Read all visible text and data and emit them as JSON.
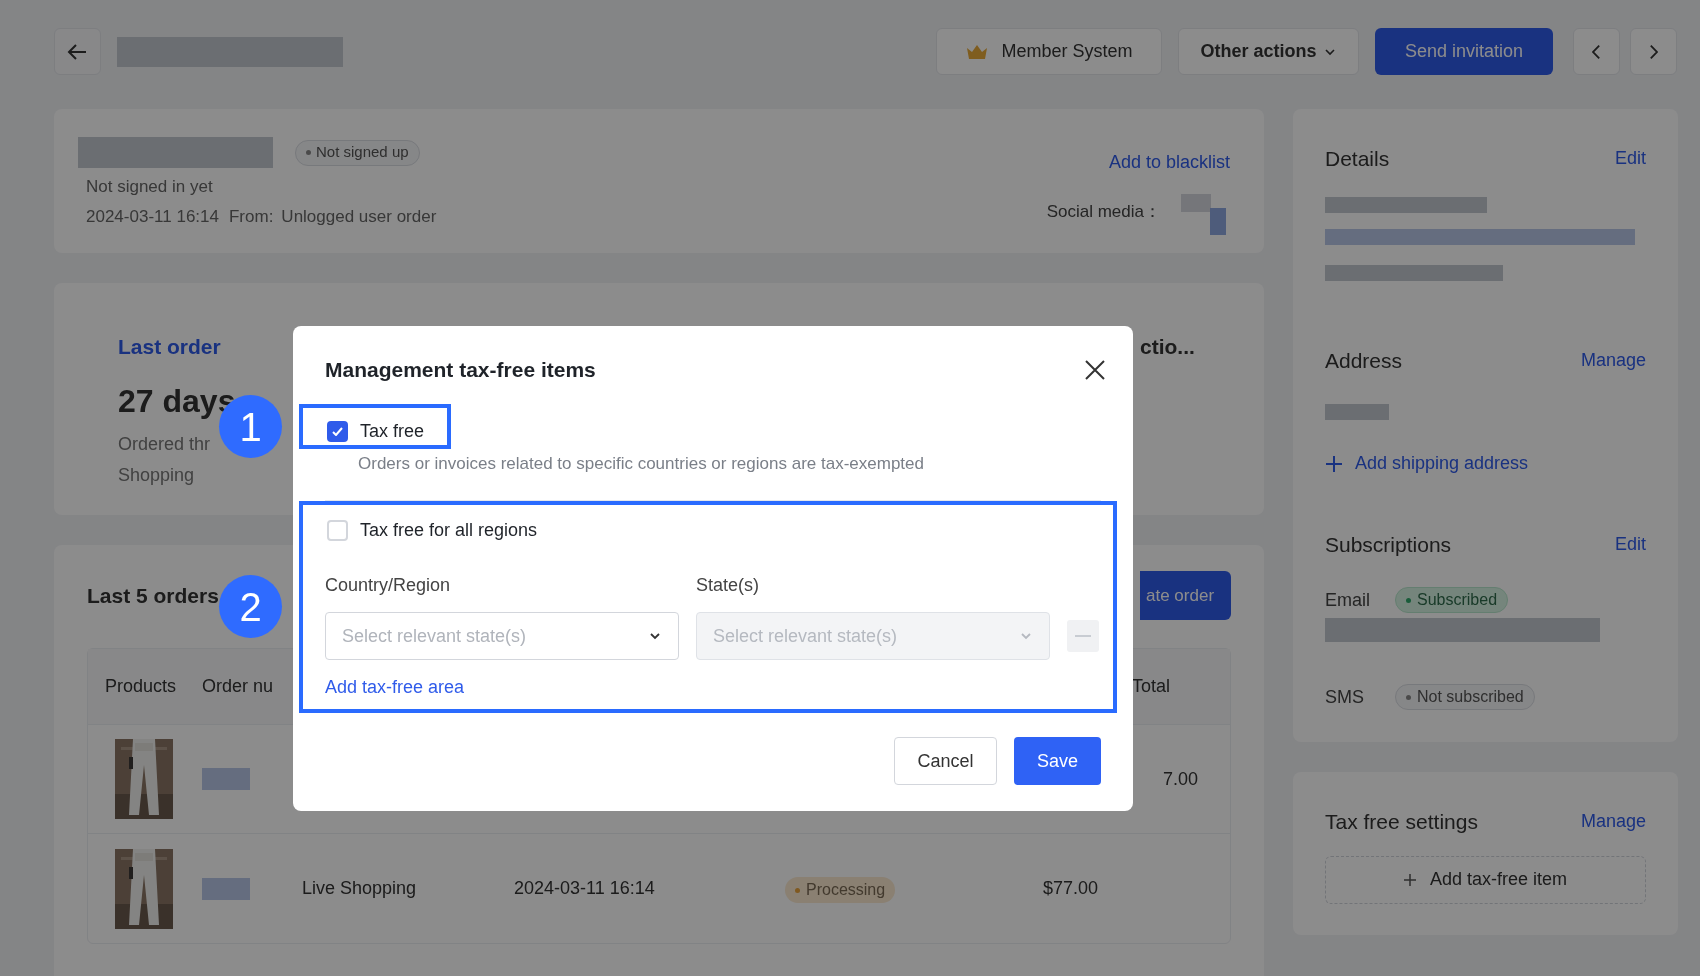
{
  "header": {
    "member_button": "Member System",
    "actions_button": "Other actions",
    "invite_button": "Send invitation"
  },
  "customer": {
    "status_badge": "Not signed up",
    "sign_in_note": "Not signed in yet",
    "created": "2024-03-11 16:14",
    "source_label": "From:",
    "source": "Unlogged user order",
    "blacklist_link": "Add to blacklist",
    "social_label": "Social media："
  },
  "last_order": {
    "title": "Last order",
    "age": "27 days",
    "channel_line": "Ordered thr",
    "channel_line_2": "Shopping",
    "column_2_title": "ctio..."
  },
  "orders": {
    "title": "Last 5 orders",
    "create_button": "ate order",
    "columns": [
      "Products",
      "Order nu",
      "Total"
    ],
    "rows": [
      {
        "kind": "partial",
        "total": "7.00"
      },
      {
        "kind": "full",
        "channel": "Live Shopping",
        "date": "2024-03-11 16:14",
        "status": "Processing",
        "total": "$77.00"
      }
    ]
  },
  "sidebar": {
    "details": {
      "title": "Details",
      "action": "Edit"
    },
    "address": {
      "title": "Address",
      "action": "Manage",
      "add_link": "Add shipping address"
    },
    "subscriptions": {
      "title": "Subscriptions",
      "action": "Edit",
      "channels": [
        {
          "label": "Email",
          "status": "Subscribed",
          "subscribed": true
        },
        {
          "label": "SMS",
          "status": "Not subscribed",
          "subscribed": false
        }
      ]
    },
    "tax_free": {
      "title": "Tax free settings",
      "action": "Manage",
      "add_button": "Add tax-free item"
    }
  },
  "modal": {
    "title": "Management tax-free items",
    "tax_free": {
      "label": "Tax free",
      "checked": true,
      "description": "Orders or invoices related to specific countries or regions are tax-exempted"
    },
    "all_regions": {
      "label": "Tax free for all regions",
      "checked": false
    },
    "fields": [
      {
        "label": "Country/Region",
        "placeholder": "Select relevant state(s)",
        "disabled": false
      },
      {
        "label": "State(s)",
        "placeholder": "Select relevant state(s)",
        "disabled": true
      }
    ],
    "add_link": "Add tax-free area",
    "cancel_button": "Cancel",
    "save_button": "Save"
  },
  "annotations": [
    "1",
    "2"
  ]
}
